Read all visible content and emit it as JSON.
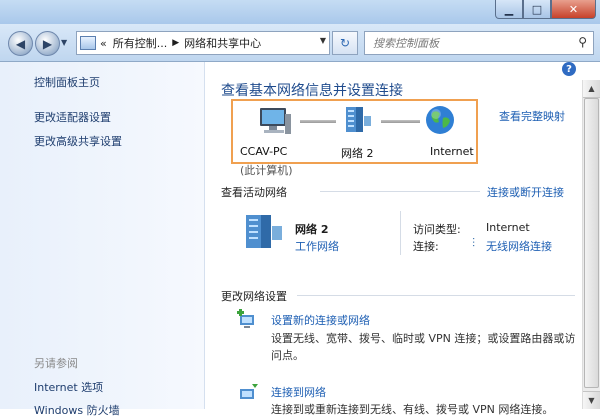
{
  "window": {
    "minimize_icon": "minimize-icon",
    "maximize_icon": "maximize-icon",
    "close_icon": "close-icon"
  },
  "navbar": {
    "back_icon": "back-arrow-icon",
    "forward_icon": "forward-arrow-icon",
    "address": {
      "prefix": "«",
      "segments": [
        "所有控制...",
        "网络和共享中心"
      ]
    },
    "search_placeholder": "搜索控制面板"
  },
  "sidebar": {
    "items": [
      "控制面板主页",
      "更改适配器设置",
      "更改高级共享设置"
    ],
    "see_also_title": "另请参阅",
    "see_also_items": [
      "Internet 选项",
      "Windows 防火墙"
    ]
  },
  "main": {
    "title": "查看基本网络信息并设置连接",
    "full_map_link": "查看完整映射",
    "map": {
      "nodes": [
        "CCAV-PC",
        "网络 2",
        "Internet"
      ],
      "pc_caption": "(此计算机)"
    },
    "active_section": {
      "title": "查看活动网络",
      "connect_link": "连接或断开连接",
      "network_name": "网络 2",
      "network_type": "工作网络",
      "access_type_label": "访问类型:",
      "access_type_value": "Internet",
      "connection_label": "连接:",
      "connection_value": "无线网络连接"
    },
    "change_section": {
      "title": "更改网络设置",
      "tasks": [
        {
          "link": "设置新的连接或网络",
          "desc": "设置无线、宽带、拨号、临时或 VPN 连接；或设置路由器或访问点。"
        },
        {
          "link": "连接到网络",
          "desc": "连接到或重新连接到无线、有线、拨号或 VPN 网络连接。"
        }
      ]
    }
  },
  "colors": {
    "link": "#1e5fb3",
    "title": "#1f4b8d",
    "highlight_box": "#f0a050"
  }
}
